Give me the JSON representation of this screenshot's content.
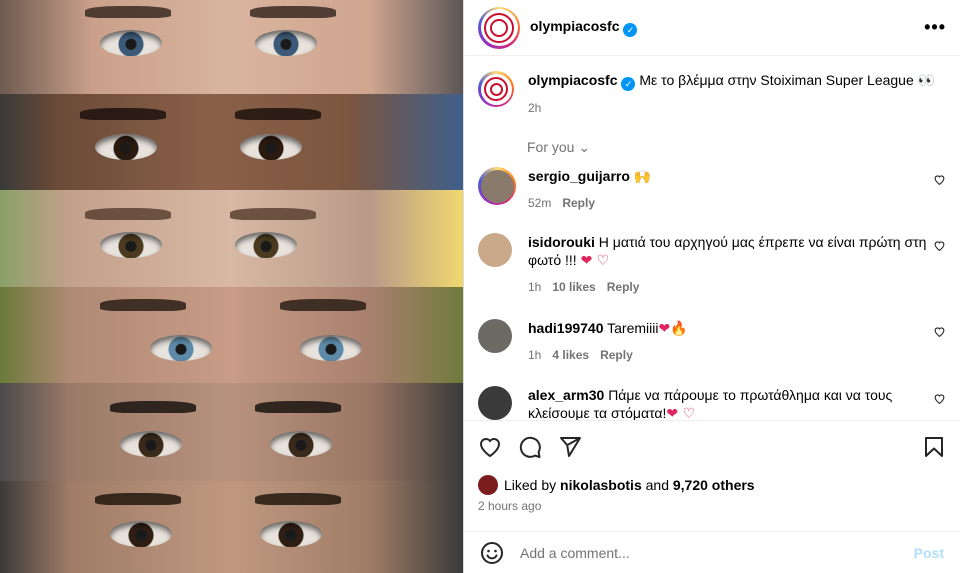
{
  "post": {
    "author": "olympiacosfc",
    "verified_mark": "✓",
    "more_label": "•••",
    "caption": "Με το βλέμμα στην Stoiximan Super League",
    "caption_emoji": "👀",
    "caption_time": "2h",
    "for_you_label": "For you",
    "for_you_chevron": "⌄"
  },
  "comments": [
    {
      "user": "sergio_guijarro",
      "text": "",
      "emoji": "🙌",
      "time": "52m",
      "likes": "",
      "reply": "Reply",
      "avatar_color": "#8a7a6c"
    },
    {
      "user": "isidorouki",
      "text": "Η ματιά του αρχηγού μας έπρεπε να είναι πρώτη στη φωτό !!!",
      "emoji": "❤ ♡",
      "time": "1h",
      "likes": "10 likes",
      "reply": "Reply",
      "avatar_color": "#c9a98a"
    },
    {
      "user": "hadi199740",
      "text": "Taremiiii",
      "emoji": "❤🔥",
      "time": "1h",
      "likes": "4 likes",
      "reply": "Reply",
      "avatar_color": "#6d6a66"
    },
    {
      "user": "alex_arm30",
      "text": "Πάμε να πάρουμε το πρωτάθλημα και να τους κλείσουμε τα στόματα!",
      "emoji": "❤ ♡",
      "time": "",
      "likes": "",
      "reply": "",
      "avatar_color": "#3a3a3a"
    }
  ],
  "actions": {
    "liked_prefix": "Liked by",
    "liked_user": "nikolasbotis",
    "liked_and": "and",
    "liked_others": "9,720 others",
    "posted_ago": "2 hours ago"
  },
  "comment_box": {
    "placeholder": "Add a comment...",
    "post_label": "Post",
    "emoji_icon": "smiley-icon"
  },
  "colors": {
    "accent_blue": "#0095f6",
    "post_disabled": "#b2dffc",
    "secondary_text": "#737373",
    "brand_red": "#c8102e"
  }
}
